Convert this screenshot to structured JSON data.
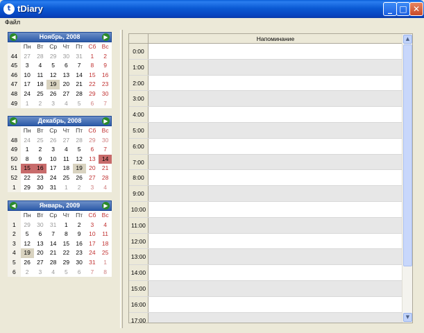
{
  "window": {
    "title": "tDiary",
    "icon_name": "tdiary-app-icon"
  },
  "menu": {
    "file": "Файл"
  },
  "calendars": [
    {
      "title": "Ноябрь, 2008",
      "headers": [
        "Пн",
        "Вт",
        "Ср",
        "Чт",
        "Пт",
        "Сб",
        "Вс"
      ],
      "weeks": [
        {
          "wk": "44",
          "days": [
            "27",
            "28",
            "29",
            "30",
            "31",
            "1",
            "2"
          ],
          "other": [
            1,
            1,
            1,
            1,
            1,
            0,
            0
          ]
        },
        {
          "wk": "45",
          "days": [
            "3",
            "4",
            "5",
            "6",
            "7",
            "8",
            "9"
          ],
          "other": [
            0,
            0,
            0,
            0,
            0,
            0,
            0
          ]
        },
        {
          "wk": "46",
          "days": [
            "10",
            "11",
            "12",
            "13",
            "14",
            "15",
            "16"
          ],
          "other": [
            0,
            0,
            0,
            0,
            0,
            0,
            0
          ]
        },
        {
          "wk": "47",
          "days": [
            "17",
            "18",
            "19",
            "20",
            "21",
            "22",
            "23"
          ],
          "other": [
            0,
            0,
            0,
            0,
            0,
            0,
            0
          ]
        },
        {
          "wk": "48",
          "days": [
            "24",
            "25",
            "26",
            "27",
            "28",
            "29",
            "30"
          ],
          "other": [
            0,
            0,
            0,
            0,
            0,
            0,
            0
          ]
        },
        {
          "wk": "49",
          "days": [
            "1",
            "2",
            "3",
            "4",
            "5",
            "6",
            "7"
          ],
          "other": [
            1,
            1,
            1,
            1,
            1,
            1,
            1
          ]
        }
      ]
    },
    {
      "title": "Декабрь, 2008",
      "headers": [
        "Пн",
        "Вт",
        "Ср",
        "Чт",
        "Пт",
        "Сб",
        "Вс"
      ],
      "weeks": [
        {
          "wk": "48",
          "days": [
            "24",
            "25",
            "26",
            "27",
            "28",
            "29",
            "30"
          ],
          "other": [
            1,
            1,
            1,
            1,
            1,
            1,
            1
          ]
        },
        {
          "wk": "49",
          "days": [
            "1",
            "2",
            "3",
            "4",
            "5",
            "6",
            "7"
          ],
          "other": [
            0,
            0,
            0,
            0,
            0,
            0,
            0
          ]
        },
        {
          "wk": "50",
          "days": [
            "8",
            "9",
            "10",
            "11",
            "12",
            "13",
            "14"
          ],
          "other": [
            0,
            0,
            0,
            0,
            0,
            0,
            0
          ]
        },
        {
          "wk": "51",
          "days": [
            "15",
            "16",
            "17",
            "18",
            "19",
            "20",
            "21"
          ],
          "other": [
            0,
            0,
            0,
            0,
            0,
            0,
            0
          ]
        },
        {
          "wk": "52",
          "days": [
            "22",
            "23",
            "24",
            "25",
            "26",
            "27",
            "28"
          ],
          "other": [
            0,
            0,
            0,
            0,
            0,
            0,
            0
          ]
        },
        {
          "wk": "1",
          "days": [
            "29",
            "30",
            "31",
            "1",
            "2",
            "3",
            "4"
          ],
          "other": [
            0,
            0,
            0,
            1,
            1,
            1,
            1
          ]
        }
      ]
    },
    {
      "title": "Январь, 2009",
      "headers": [
        "Пн",
        "Вт",
        "Ср",
        "Чт",
        "Пт",
        "Сб",
        "Вс"
      ],
      "weeks": [
        {
          "wk": "1",
          "days": [
            "29",
            "30",
            "31",
            "1",
            "2",
            "3",
            "4"
          ],
          "other": [
            1,
            1,
            1,
            0,
            0,
            0,
            0
          ]
        },
        {
          "wk": "2",
          "days": [
            "5",
            "6",
            "7",
            "8",
            "9",
            "10",
            "11"
          ],
          "other": [
            0,
            0,
            0,
            0,
            0,
            0,
            0
          ]
        },
        {
          "wk": "3",
          "days": [
            "12",
            "13",
            "14",
            "15",
            "16",
            "17",
            "18"
          ],
          "other": [
            0,
            0,
            0,
            0,
            0,
            0,
            0
          ]
        },
        {
          "wk": "4",
          "days": [
            "19",
            "20",
            "21",
            "22",
            "23",
            "24",
            "25"
          ],
          "other": [
            0,
            0,
            0,
            0,
            0,
            0,
            0
          ]
        },
        {
          "wk": "5",
          "days": [
            "26",
            "27",
            "28",
            "29",
            "30",
            "31",
            "1"
          ],
          "other": [
            0,
            0,
            0,
            0,
            0,
            0,
            1
          ]
        },
        {
          "wk": "6",
          "days": [
            "2",
            "3",
            "4",
            "5",
            "6",
            "7",
            "8"
          ],
          "other": [
            1,
            1,
            1,
            1,
            1,
            1,
            1
          ]
        }
      ]
    }
  ],
  "schedule": {
    "column_header": "Напоминание",
    "times": [
      "0:00",
      "1:00",
      "2:00",
      "3:00",
      "4:00",
      "5:00",
      "6:00",
      "7:00",
      "8:00",
      "9:00",
      "10:00",
      "11:00",
      "12:00",
      "13:00",
      "14:00",
      "15:00",
      "16:00",
      "17:00"
    ]
  },
  "colors": {
    "titlebar": "#0845c0",
    "weekend": "#c03030",
    "marked_day": "#c86b6b",
    "alt_row": "#e7e7e7"
  }
}
